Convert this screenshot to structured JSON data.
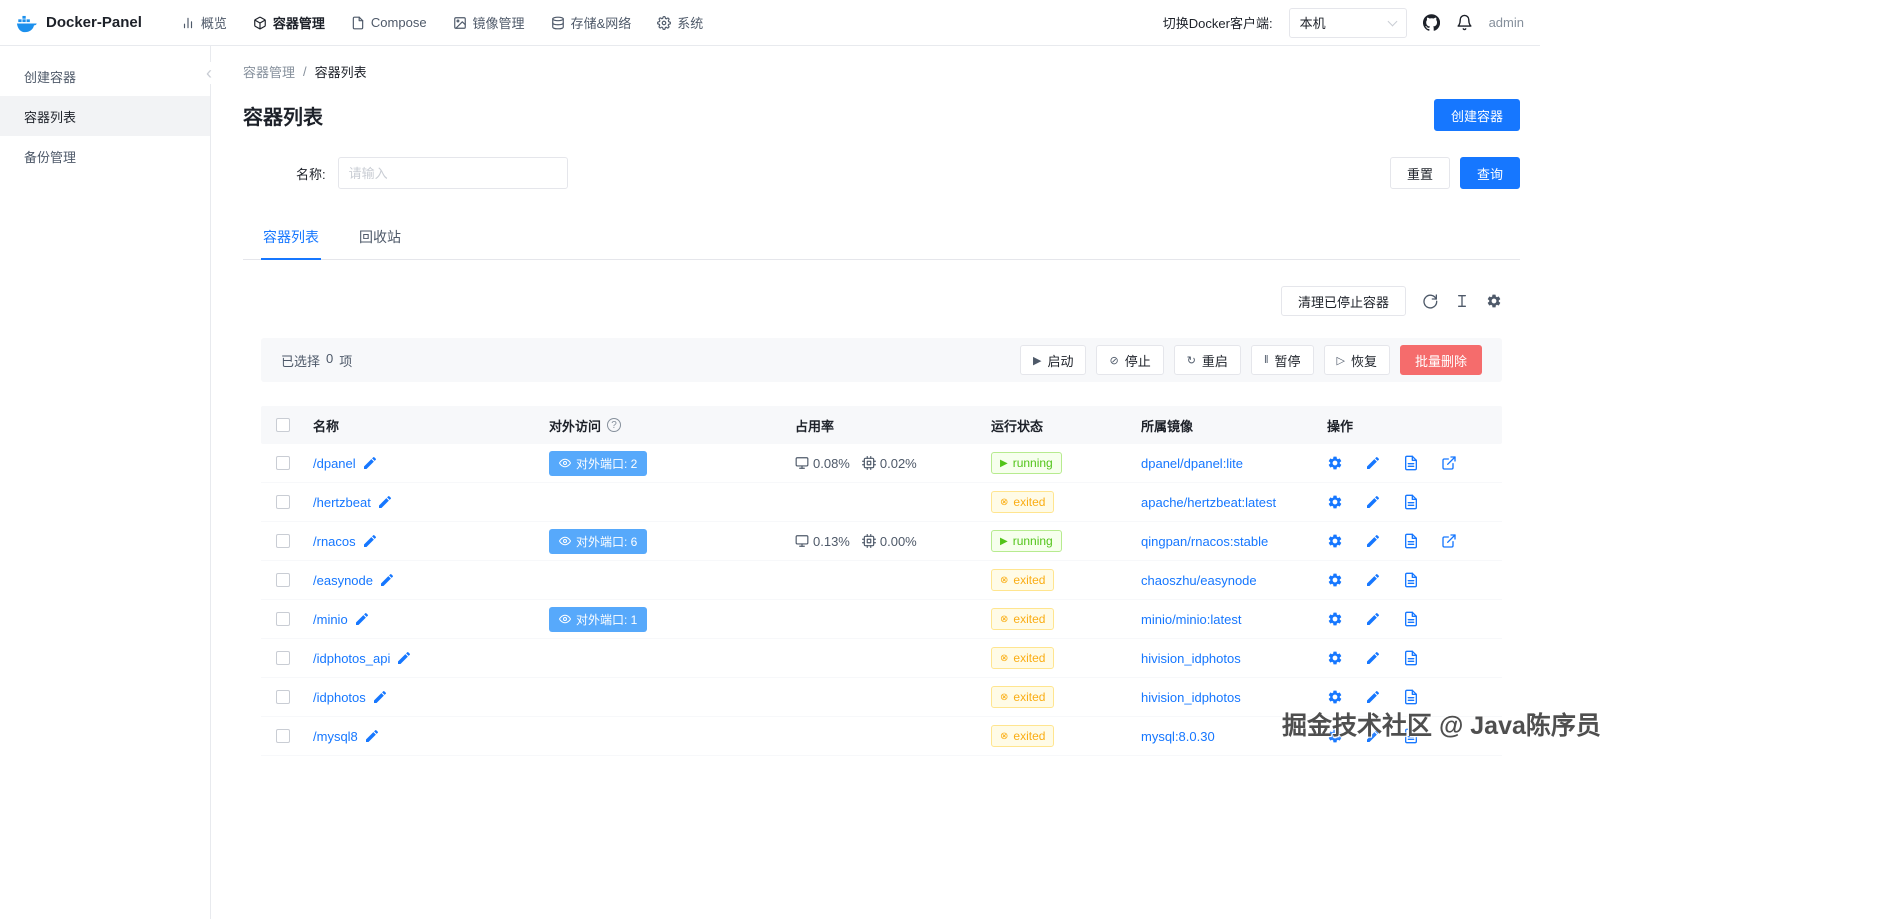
{
  "colors": {
    "primary": "#1677ff",
    "portBlue": "#57a9fb",
    "success": "#52c41a",
    "warning": "#faad14",
    "danger": "#f56c6c"
  },
  "navbar": {
    "brand": "Docker-Panel",
    "items": [
      {
        "label": "概览",
        "icon": "chart-icon",
        "name": "overview",
        "active": false
      },
      {
        "label": "容器管理",
        "icon": "container-icon",
        "name": "container-management",
        "active": true
      },
      {
        "label": "Compose",
        "icon": "compose-icon",
        "name": "compose",
        "active": false
      },
      {
        "label": "镜像管理",
        "icon": "image-icon",
        "name": "image-management",
        "active": false
      },
      {
        "label": "存储&网络",
        "icon": "storage-network-icon",
        "name": "storage-network",
        "active": false
      },
      {
        "label": "系统",
        "icon": "system-icon",
        "name": "system",
        "active": false
      }
    ],
    "client_switch_label": "切换Docker客户端:",
    "client_value": "本机",
    "user": "admin"
  },
  "sidebar": {
    "items": [
      {
        "label": "创建容器",
        "name": "create-container",
        "active": false
      },
      {
        "label": "容器列表",
        "name": "container-list",
        "active": true
      },
      {
        "label": "备份管理",
        "name": "backup-management",
        "active": false
      }
    ]
  },
  "breadcrumb": [
    "容器管理",
    "容器列表"
  ],
  "page": {
    "title": "容器列表",
    "create_button": "创建容器"
  },
  "filter": {
    "name_label": "名称:",
    "name_placeholder": "请输入",
    "reset": "重置",
    "search": "查询"
  },
  "tabs": [
    {
      "label": "容器列表",
      "name": "container-list",
      "active": true
    },
    {
      "label": "回收站",
      "name": "recycle-bin",
      "active": false
    }
  ],
  "toolbar": {
    "clean_button": "清理已停止容器"
  },
  "batch": {
    "selected_prefix": "已选择",
    "selected_count": "0",
    "selected_suffix": "项",
    "actions": [
      {
        "label": "启动",
        "name": "start",
        "glyph": "▶"
      },
      {
        "label": "停止",
        "name": "stop",
        "glyph": "⊘"
      },
      {
        "label": "重启",
        "name": "restart",
        "glyph": "↻"
      },
      {
        "label": "暂停",
        "name": "pause",
        "glyph": "‖"
      },
      {
        "label": "恢复",
        "name": "resume",
        "glyph": "▷"
      }
    ],
    "delete_label": "批量删除"
  },
  "table": {
    "headers": [
      {
        "label": "名称"
      },
      {
        "label": "对外访问",
        "help": true
      },
      {
        "label": "占用率"
      },
      {
        "label": "运行状态"
      },
      {
        "label": "所属镜像"
      },
      {
        "label": "操作"
      }
    ],
    "rows": [
      {
        "name": "/dpanel",
        "ports": "对外端口: 2",
        "cpu": "0.08%",
        "mem": "0.02%",
        "status": "running",
        "image": "dpanel/dpanel:lite",
        "external": true
      },
      {
        "name": "/hertzbeat",
        "ports": "",
        "cpu": "",
        "mem": "",
        "status": "exited",
        "image": "apache/hertzbeat:latest",
        "external": false
      },
      {
        "name": "/rnacos",
        "ports": "对外端口: 6",
        "cpu": "0.13%",
        "mem": "0.00%",
        "status": "running",
        "image": "qingpan/rnacos:stable",
        "external": true
      },
      {
        "name": "/easynode",
        "ports": "",
        "cpu": "",
        "mem": "",
        "status": "exited",
        "image": "chaoszhu/easynode",
        "external": false
      },
      {
        "name": "/minio",
        "ports": "对外端口: 1",
        "cpu": "",
        "mem": "",
        "status": "exited",
        "image": "minio/minio:latest",
        "external": false
      },
      {
        "name": "/idphotos_api",
        "ports": "",
        "cpu": "",
        "mem": "",
        "status": "exited",
        "image": "hivision_idphotos",
        "external": false
      },
      {
        "name": "/idphotos",
        "ports": "",
        "cpu": "",
        "mem": "",
        "status": "exited",
        "image": "hivision_idphotos",
        "external": false
      },
      {
        "name": "/mysql8",
        "ports": "",
        "cpu": "",
        "mem": "",
        "status": "exited",
        "image": "mysql:8.0.30",
        "external": false
      }
    ]
  },
  "watermark": "掘金技术社区 @ Java陈序员"
}
